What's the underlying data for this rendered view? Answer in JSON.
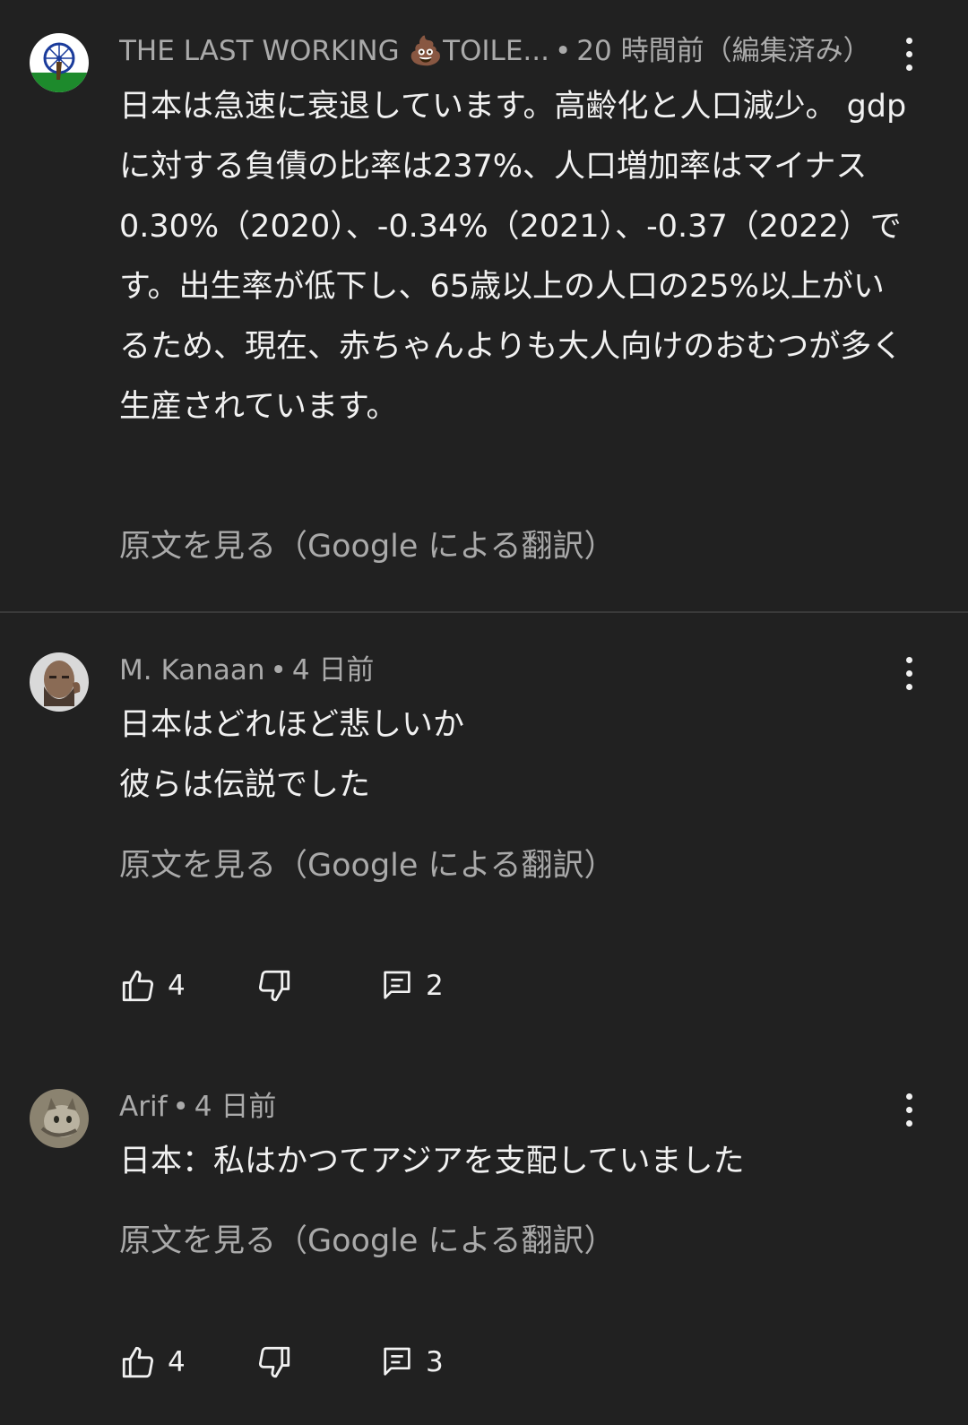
{
  "comments": [
    {
      "author": "THE LAST WORKING 💩TOILE...",
      "time": "20 時間前（編集済み）",
      "text": "日本は急速に衰退しています。高齢化と人口減少。 gdpに対する負債の比率は237%、人口増加率はマイナス\n0.30%（2020）、-0.34%（2021）、-0.37（2022）です。出生率が低下し、65歳以上の人口の25%以上がいるため、現在、赤ちゃんよりも大人向けのおむつが多く生産されています。",
      "translate_link": "原文を見る（Google による翻訳）",
      "avatar_icon": "india-flag-avatar-icon"
    },
    {
      "author": "M. Kanaan",
      "time": "4 日前",
      "text": "日本はどれほど悲しいか\n彼らは伝説でした",
      "translate_link": "原文を見る（Google による翻訳）",
      "like_count": "4",
      "reply_count": "2",
      "avatar_icon": "bearded-man-avatar-icon"
    },
    {
      "author": "Arif",
      "time": "4 日前",
      "text": "日本：私はかつてアジアを支配していました",
      "translate_link": "原文を見る（Google による翻訳）",
      "like_count": "4",
      "reply_count": "3",
      "avatar_icon": "cat-avatar-icon"
    }
  ],
  "separator": "•",
  "colors": {
    "background": "#212121",
    "primary_text": "#f1f1f1",
    "secondary_text": "#aaaaaa",
    "divider": "#3a3a3a"
  }
}
